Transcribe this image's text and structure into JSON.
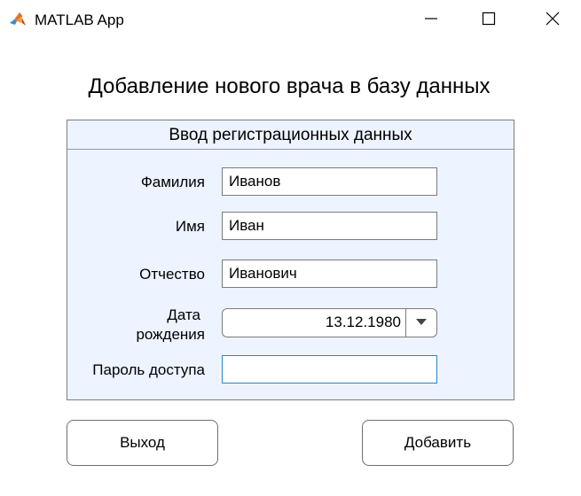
{
  "window": {
    "title": "MATLAB App"
  },
  "main": {
    "heading": "Добавление нового врача в базу данных"
  },
  "panel": {
    "title": "Ввод регистрационных данных",
    "fields": {
      "surname": {
        "label": "Фамилия",
        "value": "Иванов"
      },
      "name": {
        "label": "Имя",
        "value": "Иван"
      },
      "patronymic": {
        "label": "Отчество",
        "value": "Иванович"
      },
      "birthdate": {
        "label_line1": "Дата",
        "label_line2": "рождения",
        "value": "13.12.1980"
      },
      "password": {
        "label": "Пароль доступа",
        "value": ""
      }
    }
  },
  "buttons": {
    "exit_label": "Выход",
    "add_label": "Добавить"
  },
  "colors": {
    "panel_background": "#edf3ff",
    "focus_border": "#2b86c6"
  },
  "icons": {
    "app": "matlab-logo-icon",
    "minimize": "minimize-icon",
    "maximize": "maximize-icon",
    "close": "close-icon",
    "dropdown": "dropdown-arrow-icon"
  }
}
